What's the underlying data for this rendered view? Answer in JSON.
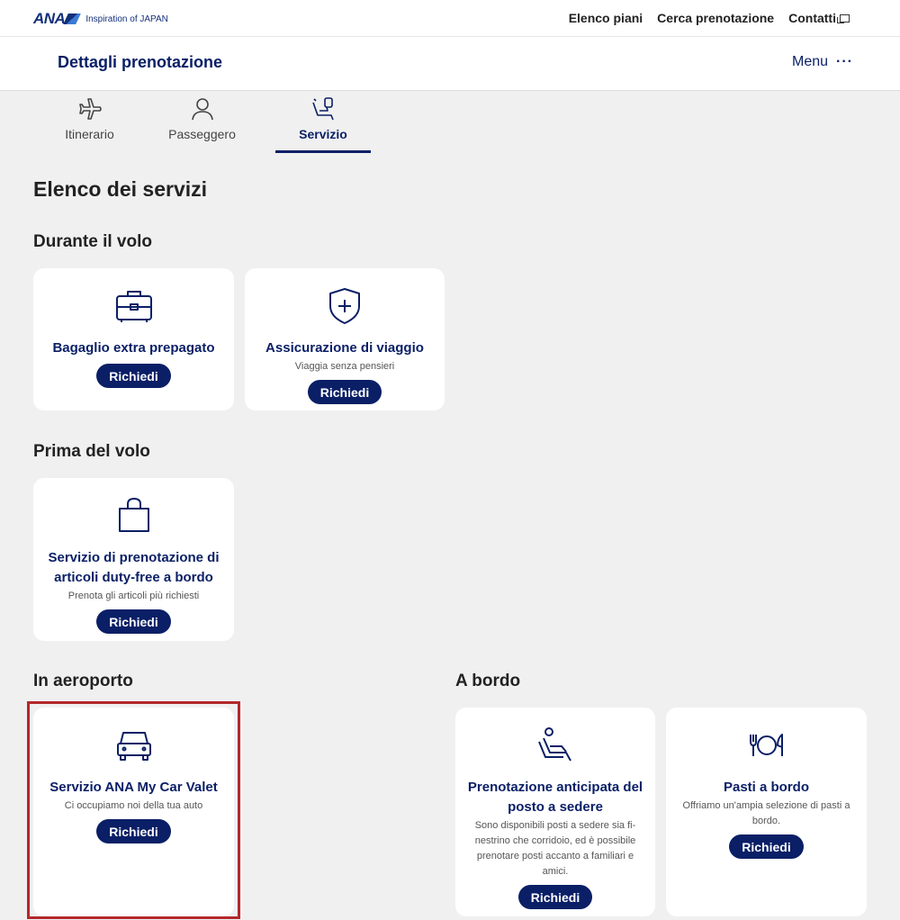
{
  "brand": {
    "logo_text": "ANA",
    "tagline": "Inspiration of JAPAN"
  },
  "topnav": {
    "plans": "Elenco piani",
    "search_booking": "Cerca prenotazione",
    "contacts": "Contatti"
  },
  "subheader": {
    "title": "Dettagli prenotazione",
    "menu_label": "Menu",
    "menu_dots": "···"
  },
  "tabs": [
    {
      "label": "Itinerario",
      "icon": "plane-icon"
    },
    {
      "label": "Passeggero",
      "icon": "person-icon"
    },
    {
      "label": "Servizio",
      "icon": "seat-icon"
    }
  ],
  "page_title": "Elenco dei servizi",
  "sections": {
    "during_flight": {
      "title": "Durante il volo",
      "cards": [
        {
          "title": "Bagaglio extra prepagato",
          "desc": "",
          "button": "Richiedi",
          "icon": "suitcase-icon"
        },
        {
          "title": "Assicurazione di viaggio",
          "desc": "Viaggia senza pensieri",
          "button": "Richiedi",
          "icon": "shield-plus-icon"
        }
      ]
    },
    "before_flight": {
      "title": "Prima del volo",
      "cards": [
        {
          "title": "Servizio di prenotazione di articoli duty-free a bordo",
          "desc": "Prenota gli articoli più richiesti",
          "button": "Richiedi",
          "icon": "shopping-bag-icon"
        }
      ]
    },
    "airport": {
      "title": "In aeroporto",
      "cards": [
        {
          "title": "Servizio ANA My Car Valet",
          "desc": "Ci occupiamo noi della tua auto",
          "button": "Richiedi",
          "icon": "car-icon"
        }
      ]
    },
    "onboard": {
      "title": "A bordo",
      "cards": [
        {
          "title": "Prenotazione anticipata del posto a sedere",
          "desc": "Sono disponibili posti a sedere sia fi-nestrino che corridoio, ed è possibile prenotare posti accanto a familiari e amici.",
          "button": "Richiedi",
          "icon": "seat-icon"
        },
        {
          "title": "Pasti a bordo",
          "desc": "Offriamo un'ampia selezione di pasti a bordo.",
          "button": "Richiedi",
          "icon": "meal-icon"
        }
      ]
    }
  },
  "colors": {
    "brand_navy": "#0a1f66",
    "highlight": "#b3282b",
    "background": "#f0f0f0"
  }
}
